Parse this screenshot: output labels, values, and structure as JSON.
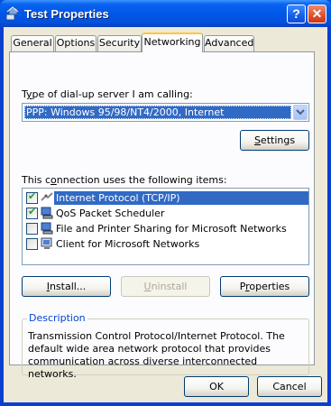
{
  "window": {
    "title": "Test Properties",
    "help_label": "?",
    "close_label": "✕"
  },
  "tabs": [
    {
      "label": "General"
    },
    {
      "label": "Options"
    },
    {
      "label": "Security"
    },
    {
      "label": "Networking",
      "active": true
    },
    {
      "label": "Advanced"
    }
  ],
  "networking": {
    "server_label_prefix": "T",
    "server_label_underlined": "y",
    "server_label_rest": "pe of dial-up server I am calling:",
    "server_value": "PPP: Windows 95/98/NT4/2000, Internet",
    "settings_button": {
      "prefix": "",
      "underlined": "S",
      "rest": "ettings"
    },
    "items_label_prefix": "This c",
    "items_label_underlined": "o",
    "items_label_rest": "nnection uses the following items:",
    "items": [
      {
        "label": "Internet Protocol (TCP/IP)",
        "checked": true,
        "selected": true,
        "icon": "network-protocol-icon"
      },
      {
        "label": "QoS Packet Scheduler",
        "checked": true,
        "selected": false,
        "icon": "network-service-icon"
      },
      {
        "label": "File and Printer Sharing for Microsoft Networks",
        "checked": false,
        "selected": false,
        "icon": "network-service-icon"
      },
      {
        "label": "Client for Microsoft Networks",
        "checked": false,
        "selected": false,
        "icon": "network-client-icon"
      }
    ],
    "install_button": {
      "prefix": "",
      "underlined": "I",
      "rest": "nstall..."
    },
    "uninstall_button": {
      "prefix": "",
      "underlined": "U",
      "rest": "ninstall"
    },
    "properties_button": {
      "prefix": "P",
      "underlined": "r",
      "rest": "operties"
    },
    "description_title": "Description",
    "description_text": "Transmission Control Protocol/Internet Protocol. The default wide area network protocol that provides communication across diverse interconnected networks."
  },
  "footer": {
    "ok": "OK",
    "cancel": "Cancel"
  }
}
